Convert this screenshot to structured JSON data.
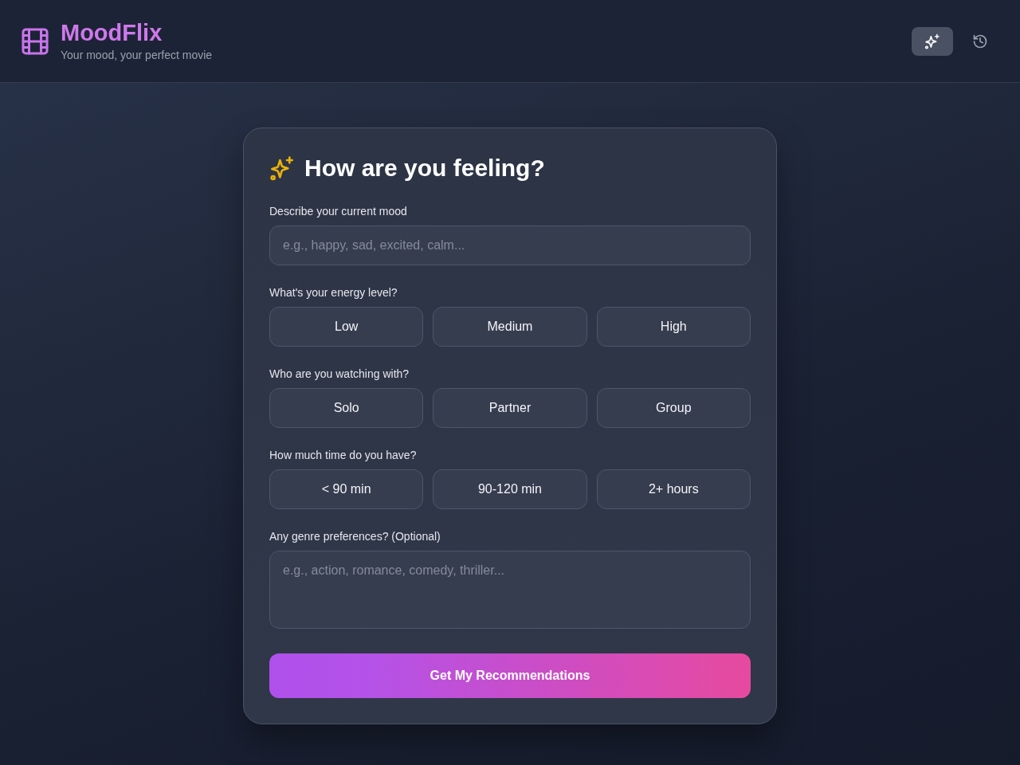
{
  "header": {
    "title": "MoodFlix",
    "subtitle": "Your mood, your perfect movie",
    "nav": [
      {
        "kind": "discover",
        "selected": true
      },
      {
        "kind": "history",
        "selected": false
      }
    ]
  },
  "form": {
    "title": "How are you feeling?",
    "fields": [
      {
        "kind": "text",
        "label": "Describe your current mood",
        "placeholder": "e.g., happy, sad, excited, calm..."
      },
      {
        "kind": "choice",
        "label": "What's your energy level?",
        "options": [
          {
            "label": "Low",
            "selected": false
          },
          {
            "label": "Medium",
            "selected": false
          },
          {
            "label": "High",
            "selected": false
          }
        ]
      },
      {
        "kind": "choice",
        "label": "Who are you watching with?",
        "options": [
          {
            "label": "Solo",
            "selected": false
          },
          {
            "label": "Partner",
            "selected": false
          },
          {
            "label": "Group",
            "selected": false
          }
        ]
      },
      {
        "kind": "choice",
        "label": "How much time do you have?",
        "options": [
          {
            "label": "< 90 min",
            "selected": false
          },
          {
            "label": "90-120 min",
            "selected": false
          },
          {
            "label": "2+ hours",
            "selected": false
          }
        ]
      },
      {
        "kind": "textarea",
        "label": "Any genre preferences? (Optional)",
        "placeholder": "e.g., action, romance, comedy, thriller..."
      }
    ],
    "submit": "Get My Recommendations"
  }
}
